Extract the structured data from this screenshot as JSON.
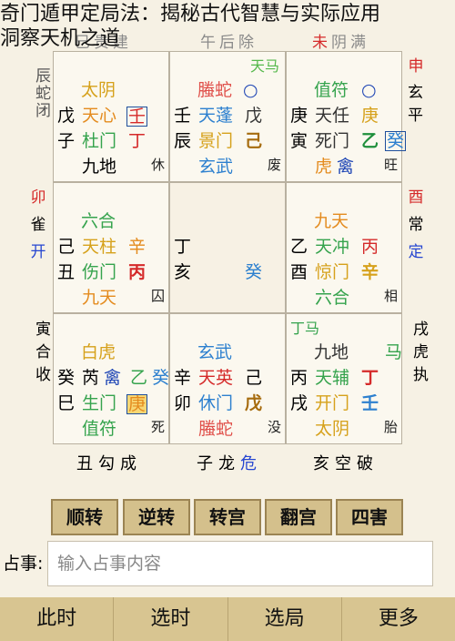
{
  "title": "奇门遁甲定局法：揭秘古代智慧与实际应用\n洞察天机之道",
  "top": {
    "left": "巳贵建",
    "center": "午后除",
    "right_red": "未",
    "right_rest": "阴满"
  },
  "sides": {
    "left_top": "辰蛇闭",
    "left_mid_red": "卯",
    "left_mid": "雀",
    "left_mid_blue": "开",
    "left_bottom": "寅合收",
    "right_top_red": "申",
    "right_top": "玄平",
    "right_mid_red": "酉",
    "right_mid": "常",
    "right_mid_blue": "定",
    "right_bottom": "戌虎执"
  },
  "cells": {
    "c00": {
      "a": "太阴",
      "b": "戊",
      "c": "天心",
      "d": "壬",
      "e": "子",
      "f": "杜门",
      "g": "丁",
      "h": "九地",
      "i": "休"
    },
    "c01": {
      "a": "螣蛇",
      "b": "壬",
      "c": "天蓬",
      "d": "戊",
      "e": "辰",
      "f": "景门",
      "g": "己",
      "h": "玄武",
      "i": "废",
      "j": "天马",
      "k": "○"
    },
    "c02": {
      "a": "值符",
      "b": "庚",
      "c": "天任",
      "d": "庚",
      "e": "寅",
      "f": "死门",
      "g": "乙",
      "h": "虎",
      "i": "旺",
      "j": "癸",
      "k": "禽"
    },
    "c10": {
      "a": "六合",
      "b": "己",
      "c": "天柱",
      "d": "辛",
      "e": "丑",
      "f": "伤门",
      "g": "丙",
      "h": "九天",
      "i": "囚"
    },
    "c11": {
      "a": "丁",
      "b": "亥",
      "c": "癸"
    },
    "c12": {
      "a": "九天",
      "b": "乙",
      "c": "天冲",
      "d": "丙",
      "e": "酉",
      "f": "惊门",
      "g": "辛",
      "h": "六合",
      "i": "相"
    },
    "c20": {
      "a": "白虎",
      "b": "癸",
      "c": "芮",
      "d": "禽",
      "e": "乙",
      "f": "巳",
      "g": "生门",
      "h": "庚",
      "i": "值符",
      "j": "死",
      "k": "癸"
    },
    "c21": {
      "a": "玄武",
      "b": "辛",
      "c": "天英",
      "d": "己",
      "e": "卯",
      "f": "休门",
      "g": "戊",
      "h": "螣蛇",
      "i": "没"
    },
    "c22": {
      "a": "丁马",
      "b": "九地",
      "c": "丙",
      "d": "天辅",
      "e": "丁",
      "f": "戌",
      "g": "开门",
      "h": "壬",
      "i": "太阴",
      "j": "胎",
      "k": "马"
    }
  },
  "bottom": {
    "left": "丑勾成",
    "center_a": "子龙",
    "center_b": "危",
    "right": "亥空破"
  },
  "buttons": [
    "顺转",
    "逆转",
    "转宫",
    "翻宫",
    "四害"
  ],
  "query": {
    "label": "占事:",
    "placeholder": "输入占事内容"
  },
  "nav": [
    "此时",
    "选时",
    "选局",
    "更多"
  ]
}
